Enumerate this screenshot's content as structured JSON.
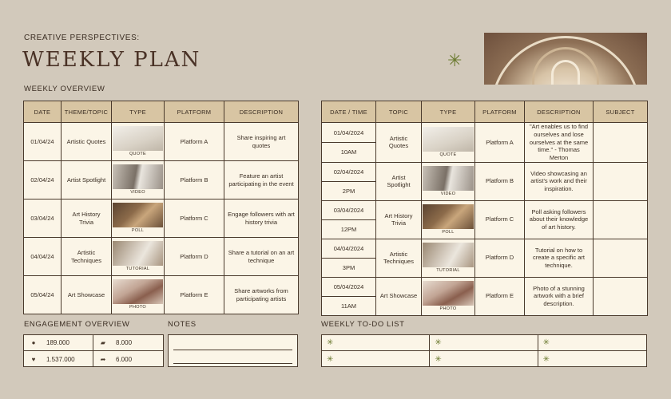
{
  "header": {
    "kicker": "CREATIVE PERSPECTIVES:",
    "title": "WEEKLY PLAN"
  },
  "overview": {
    "label": "WEEKLY OVERVIEW",
    "columns": [
      "DATE",
      "THEME/TOPIC",
      "TYPE",
      "PLATFORM",
      "DESCRIPTION"
    ],
    "rows": [
      {
        "date": "01/04/24",
        "topic": "Artistic Quotes",
        "type": "QUOTE",
        "platform": "Platform A",
        "description": "Share inspiring art quotes"
      },
      {
        "date": "02/04/24",
        "topic": "Artist Spotlight",
        "type": "VIDEO",
        "platform": "Platform B",
        "description": "Feature an artist participating in the event"
      },
      {
        "date": "03/04/24",
        "topic": "Art History Trivia",
        "type": "POLL",
        "platform": "Platform C",
        "description": "Engage followers with art history trivia"
      },
      {
        "date": "04/04/24",
        "topic": "Artistic Techniques",
        "type": "TUTORIAL",
        "platform": "Platform D",
        "description": "Share a tutorial on an art technique"
      },
      {
        "date": "05/04/24",
        "topic": "Art Showcase",
        "type": "PHOTO",
        "platform": "Platform E",
        "description": "Share artworks from participating artists"
      }
    ]
  },
  "schedule": {
    "columns": [
      "DATE / TIME",
      "TOPIC",
      "TYPE",
      "PLATFORM",
      "DESCRIPTION",
      "SUBJECT"
    ],
    "rows": [
      {
        "date": "01/04/2024",
        "time": "10AM",
        "topic": "Artistic Quotes",
        "type": "QUOTE",
        "platform": "Platform A",
        "description": "\"Art enables us to find ourselves and lose ourselves at the same time.\" - Thomas Merton",
        "subject": ""
      },
      {
        "date": "02/04/2024",
        "time": "2PM",
        "topic": "Artist Spotlight",
        "type": "VIDEO",
        "platform": "Platform B",
        "description": "Video showcasing an artist's work and their inspiration.",
        "subject": ""
      },
      {
        "date": "03/04/2024",
        "time": "12PM",
        "topic": "Art History Trivia",
        "type": "POLL",
        "platform": "Platform C",
        "description": "Poll asking followers about their knowledge of art history.",
        "subject": ""
      },
      {
        "date": "04/04/2024",
        "time": "3PM",
        "topic": "Artistic Techniques",
        "type": "TUTORIAL",
        "platform": "Platform D",
        "description": "Tutorial on how to create a specific art technique.",
        "subject": ""
      },
      {
        "date": "05/04/2024",
        "time": "11AM",
        "topic": "Art Showcase",
        "type": "PHOTO",
        "platform": "Platform E",
        "description": "Photo of a stunning artwork with a brief description.",
        "subject": ""
      }
    ]
  },
  "engagement": {
    "label": "ENGAGEMENT OVERVIEW",
    "items": [
      {
        "icon": "users-icon",
        "value": "189.000"
      },
      {
        "icon": "comment-icon",
        "value": "8.000"
      },
      {
        "icon": "heart-icon",
        "value": "1.537.000"
      },
      {
        "icon": "share-icon",
        "value": "6.000"
      }
    ]
  },
  "notes": {
    "label": "NOTES"
  },
  "todo": {
    "label": "WEEKLY TO-DO LIST",
    "items": [
      "",
      "",
      "",
      "",
      "",
      ""
    ]
  },
  "colors": {
    "background": "#d2c9bb",
    "table_header": "#d8c5a3",
    "cell": "#fbf5e7",
    "accent": "#6b7a2f",
    "title": "#4a3226"
  }
}
